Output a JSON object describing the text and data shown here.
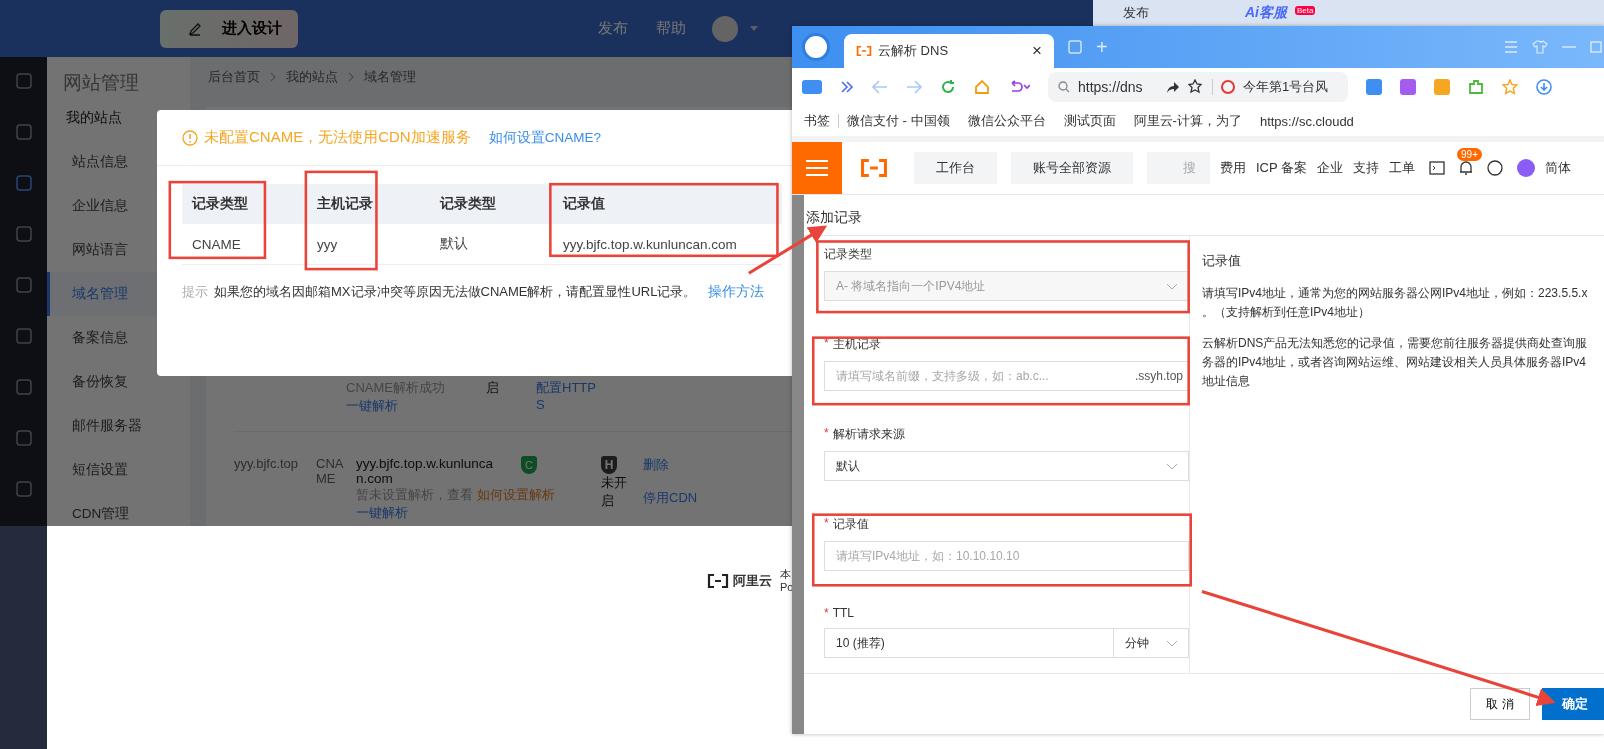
{
  "admin": {
    "header": {
      "design_button": "进入设计",
      "publish": "发布",
      "help": "帮助"
    },
    "sidebar": {
      "title": "网站管理",
      "items": [
        {
          "label": "我的站点",
          "kind": "group",
          "selected": false
        },
        {
          "label": "站点信息",
          "kind": "item",
          "selected": false
        },
        {
          "label": "企业信息",
          "kind": "item",
          "selected": false
        },
        {
          "label": "网站语言",
          "kind": "item",
          "selected": false
        },
        {
          "label": "域名管理",
          "kind": "item",
          "selected": true
        },
        {
          "label": "备案信息",
          "kind": "item",
          "selected": false
        },
        {
          "label": "备份恢复",
          "kind": "item",
          "selected": false
        },
        {
          "label": "邮件服务器",
          "kind": "item",
          "selected": false
        },
        {
          "label": "短信设置",
          "kind": "item",
          "selected": false
        },
        {
          "label": "CDN管理",
          "kind": "item",
          "selected": false
        }
      ]
    },
    "breadcrumb": [
      "后台首页",
      "我的站点",
      "域名管理"
    ],
    "partial_row": {
      "status": "CNAME解析成功",
      "action": "一键解析",
      "cert": "启",
      "ops": "配置HTTPS"
    },
    "domain_row": {
      "domain": "yyy.bjfc.top",
      "type": "CNAME",
      "value": "yyy.bjfc.top.w.kunluncan.com",
      "note": "暂未设置解析，查看 ",
      "note_link": "如何设置解析",
      "action": "一键解析",
      "cdn_badge": "C",
      "https_badge": "H",
      "https_status": "未开启",
      "ops": [
        "删除",
        "停用CDN"
      ]
    },
    "footer": {
      "brand": "阿里云",
      "text_1": "本",
      "text_2": "Po"
    }
  },
  "top_strip": {
    "publish": "发布",
    "chat_brand": "Ai客服",
    "chat_badge": "Beta"
  },
  "cname_dialog": {
    "warning": "未配置CNAME，无法使用CDN加速服务",
    "help_link": "如何设置CNAME?",
    "columns": [
      "记录类型",
      "主机记录",
      "记录类型",
      "记录值"
    ],
    "row": [
      "CNAME",
      "yyy",
      "默认",
      "yyy.bjfc.top.w.kunluncan.com"
    ],
    "hint_label": "提示",
    "hint": "如果您的域名因邮箱MX记录冲突等原因无法做CNAME解析，请配置显性URL记录。",
    "hint_link": "操作方法"
  },
  "browser": {
    "tab": {
      "title": "云解析 DNS",
      "close": "×"
    },
    "new_tab": "+",
    "address": "https://dns",
    "search": "今年第1号台风",
    "bookmarks": [
      "书签",
      "微信支付 - 中国领",
      "微信公众平台",
      "测试页面",
      "阿里云-计算，为了",
      "https://sc.cloudd"
    ],
    "console": {
      "workbench": "工作台",
      "resources": "账号全部资源",
      "search": "搜",
      "nav": [
        "费用",
        "ICP 备案",
        "企业",
        "支持",
        "工单"
      ],
      "badge": "99+",
      "language": "简体"
    },
    "dialog": {
      "title": "添加记录",
      "fields": [
        {
          "label": "记录类型",
          "kind": "select",
          "value": "A- 将域名指向一个IPV4地址",
          "disabled": true
        },
        {
          "label": "主机记录",
          "mark": "*",
          "kind": "input",
          "placeholder": "请填写域名前缀，支持多级，如：ab.c...",
          "suffix": ".ssyh.top"
        },
        {
          "label": "解析请求来源",
          "mark": "*",
          "kind": "select",
          "value": "默认",
          "disabled": false
        },
        {
          "label": "记录值",
          "mark": "*",
          "kind": "input",
          "placeholder": "请填写IPv4地址，如：10.10.10.10"
        },
        {
          "label": "TTL",
          "mark": "*",
          "kind": "ttl",
          "value": "10 (推荐)",
          "unit": "分钟"
        }
      ],
      "help_title": "记录值",
      "help": [
        "请填写IPv4地址，通常为您的网站服务器公网IPv4地址，例如：223.5.5.x 。（支持解析到任意IPv4地址）",
        "云解析DNS产品无法知悉您的记录值，需要您前往服务器提供商处查询服务器的IPv4地址，或者咨询网站运维、网站建设相关人员具体服务器IPv4地址信息"
      ],
      "cancel": "取 消",
      "confirm": "确定"
    }
  }
}
